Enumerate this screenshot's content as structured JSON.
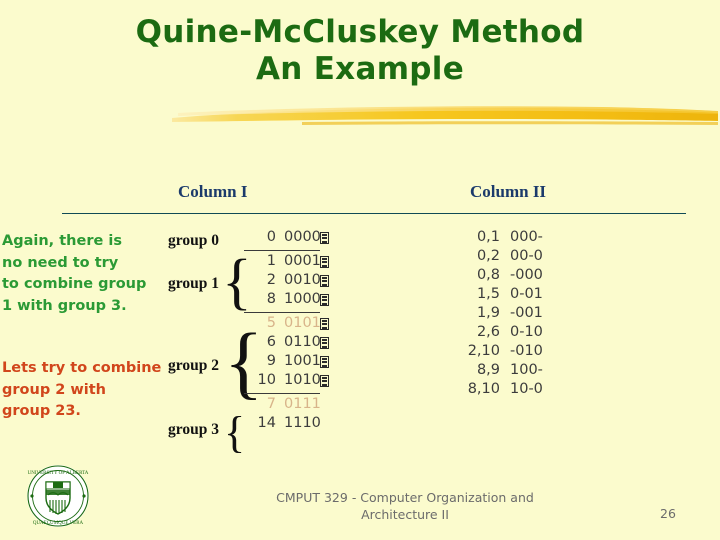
{
  "slide": {
    "background_color": "#fbfbcd",
    "title_line_1": "Quine-McCluskey Method",
    "title_line_2": "An Example",
    "title_color": "#1c6b12",
    "brush_color": "#f5c21e"
  },
  "columns": {
    "column_1_header": "Column I",
    "column_2_header": "Column II",
    "header_color": "#1b3a6b"
  },
  "notes": {
    "green_note": "Again, there is\nno need to try\nto combine group\n1 with group 3.",
    "green_color": "#2b9a35",
    "orange_note": "Lets try to combine\ngroup 2 with\ngroup 23.",
    "orange_color": "#d1461c"
  },
  "groups": [
    {
      "label": "group 0"
    },
    {
      "label": "group 1"
    },
    {
      "label": "group 2"
    },
    {
      "label": "group 3"
    }
  ],
  "column_1_rows": [
    {
      "number": "0",
      "bits": "0000",
      "checked": true,
      "faded": false
    },
    {
      "number": "1",
      "bits": "0001",
      "checked": true,
      "faded": false
    },
    {
      "number": "2",
      "bits": "0010",
      "checked": true,
      "faded": false
    },
    {
      "number": "8",
      "bits": "1000",
      "checked": true,
      "faded": false
    },
    {
      "number": "5",
      "bits": "0101",
      "checked": true,
      "faded": true
    },
    {
      "number": "6",
      "bits": "0110",
      "checked": true,
      "faded": false
    },
    {
      "number": "9",
      "bits": "1001",
      "checked": true,
      "faded": false
    },
    {
      "number": "10",
      "bits": "1010",
      "checked": true,
      "faded": false
    },
    {
      "number": "7",
      "bits": "0111",
      "checked": false,
      "faded": true
    },
    {
      "number": "14",
      "bits": "1110",
      "checked": false,
      "faded": false
    }
  ],
  "column_2_rows": [
    {
      "pair": "0,1",
      "bits": "000-"
    },
    {
      "pair": "0,2",
      "bits": "00-0"
    },
    {
      "pair": "0,8",
      "bits": "-000"
    },
    {
      "pair": "1,5",
      "bits": "0-01"
    },
    {
      "pair": "1,9",
      "bits": "-001"
    },
    {
      "pair": "2,6",
      "bits": "0-10"
    },
    {
      "pair": "2,10",
      "bits": "-010"
    },
    {
      "pair": "8,9",
      "bits": "100-"
    },
    {
      "pair": "8,10",
      "bits": "10-0"
    }
  ],
  "footer": {
    "text": "CMPUT 329 - Computer Organization and Architecture II",
    "page_number": "26",
    "logo_name": "University of Alberta seal"
  }
}
